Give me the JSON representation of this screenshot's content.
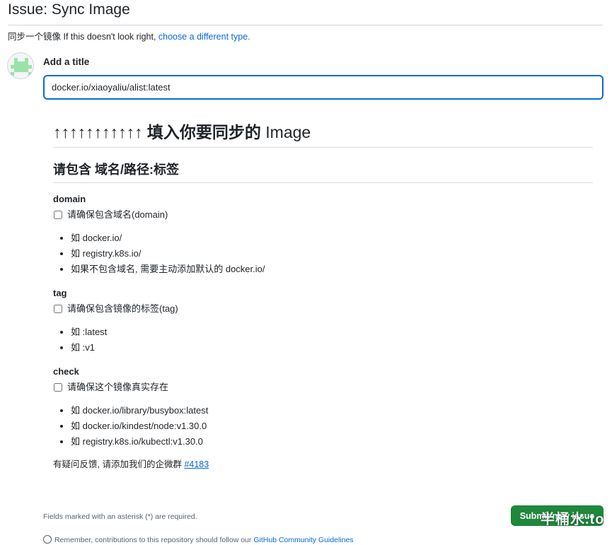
{
  "header": {
    "title": "Issue: Sync Image",
    "type_prefix": "同步一个镜像",
    "type_hint": " If this doesn't look right, ",
    "type_link": "choose a different type."
  },
  "form": {
    "title_label": "Add a title",
    "title_value": "docker.io/xiaoyaliu/alist:latest"
  },
  "body": {
    "h1_arrows": "↑↑↑↑↑↑↑↑↑↑↑",
    "h1_text": " 填入你要同步的 ",
    "h1_thin": "Image",
    "h2": "请包含 域名/路径:标签",
    "sections": [
      {
        "title": "domain",
        "check": "请确保包含域名(domain)",
        "items": [
          "如 docker.io/",
          "如 registry.k8s.io/",
          "如果不包含域名, 需要主动添加默认的 docker.io/"
        ]
      },
      {
        "title": "tag",
        "check": "请确保包含镜像的标签(tag)",
        "items": [
          "如 :latest",
          "如 :v1"
        ]
      },
      {
        "title": "check",
        "check": "请确保这个镜像真实存在",
        "items": [
          "如 docker.io/library/busybox:latest",
          "如 docker.io/kindest/node:v1.30.0",
          "如 registry.k8s.io/kubectl:v1.30.0"
        ]
      }
    ],
    "feedback_text": "有疑问反馈, 请添加我们的企微群 ",
    "feedback_link": "#4183"
  },
  "footer": {
    "required_note": "Fields marked with an asterisk (*) are required.",
    "submit_label": "Submit new issue",
    "watermark": "半桶水.to",
    "bottom_prefix": "Remember, contributions to this repository should follow our ",
    "bottom_link": "GitHub Community Guidelines"
  },
  "colors": {
    "accent": "#0969da",
    "submit": "#1f883d",
    "avatar": "#9be2a8"
  }
}
